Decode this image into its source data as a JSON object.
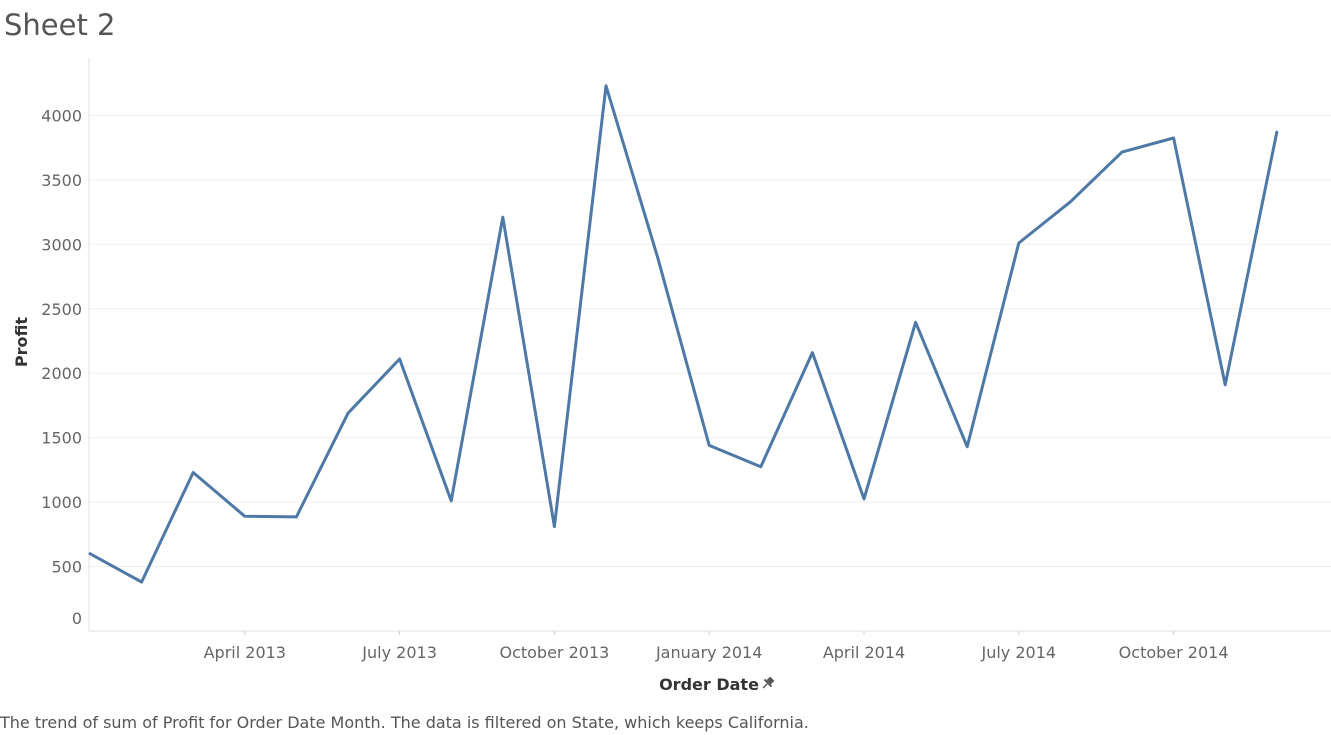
{
  "sheet": {
    "title": "Sheet 2",
    "caption": "The trend of sum of Profit for Order Date Month. The data is filtered on State, which keeps California."
  },
  "colors": {
    "line": "#4e79a7",
    "grid": "#efefef",
    "axis": "#e0e0e0",
    "text": "#666666"
  },
  "icons": {
    "x_axis_title_icon": "pin-icon"
  },
  "chart_data": {
    "type": "line",
    "xlabel": "Order Date",
    "ylabel": "Profit",
    "ylim": [
      0,
      4400
    ],
    "y_ticks": [
      0,
      500,
      1000,
      1500,
      2000,
      2500,
      3000,
      3500,
      4000
    ],
    "x_ticks": [
      {
        "label": "April 2013",
        "date": "2013-04"
      },
      {
        "label": "July 2013",
        "date": "2013-07"
      },
      {
        "label": "October 2013",
        "date": "2013-10"
      },
      {
        "label": "January 2014",
        "date": "2014-01"
      },
      {
        "label": "April 2014",
        "date": "2014-04"
      },
      {
        "label": "July 2014",
        "date": "2014-07"
      },
      {
        "label": "October 2014",
        "date": "2014-10"
      }
    ],
    "grid": true,
    "series": [
      {
        "x": [
          "2013-01",
          "2013-02",
          "2013-03",
          "2013-04",
          "2013-05",
          "2013-06",
          "2013-07",
          "2013-08",
          "2013-09",
          "2013-10",
          "2013-11",
          "2013-12",
          "2014-01",
          "2014-02",
          "2014-03",
          "2014-04",
          "2014-05",
          "2014-06",
          "2014-07",
          "2014-08",
          "2014-09",
          "2014-10",
          "2014-11",
          "2014-12"
        ],
        "values": [
          600,
          380,
          1230,
          890,
          885,
          1690,
          2110,
          1010,
          3210,
          810,
          4230,
          2900,
          1440,
          1275,
          2160,
          1025,
          2395,
          1430,
          3010,
          3330,
          3715,
          3825,
          1910,
          3870
        ]
      }
    ]
  }
}
